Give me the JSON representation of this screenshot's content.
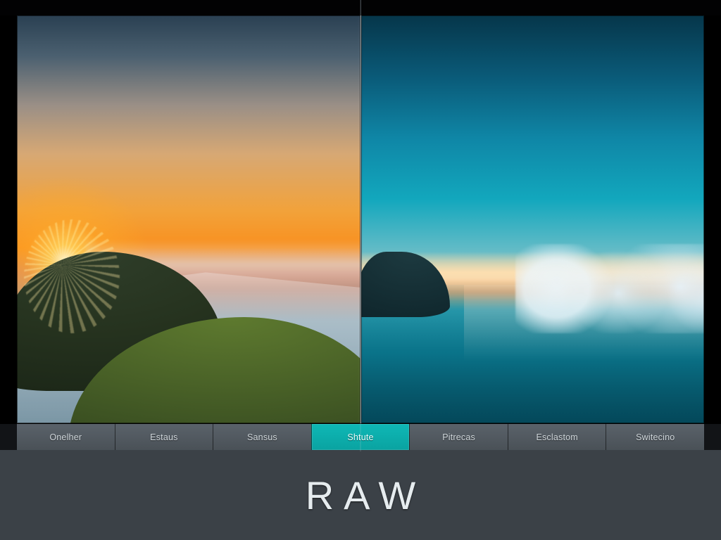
{
  "tabs": [
    {
      "label": "Onelher",
      "active": false
    },
    {
      "label": "Estaus",
      "active": false
    },
    {
      "label": "Sansus",
      "active": false
    },
    {
      "label": "Shtute",
      "active": true
    },
    {
      "label": "Pitrecas",
      "active": false
    },
    {
      "label": "Esclastom",
      "active": false
    },
    {
      "label": "Switecino",
      "active": false
    }
  ],
  "footer": {
    "title": "RAW"
  },
  "colors": {
    "accent": "#0fb8b6",
    "tab_bg": "#4f565d",
    "footer_bg": "#3b4147"
  }
}
